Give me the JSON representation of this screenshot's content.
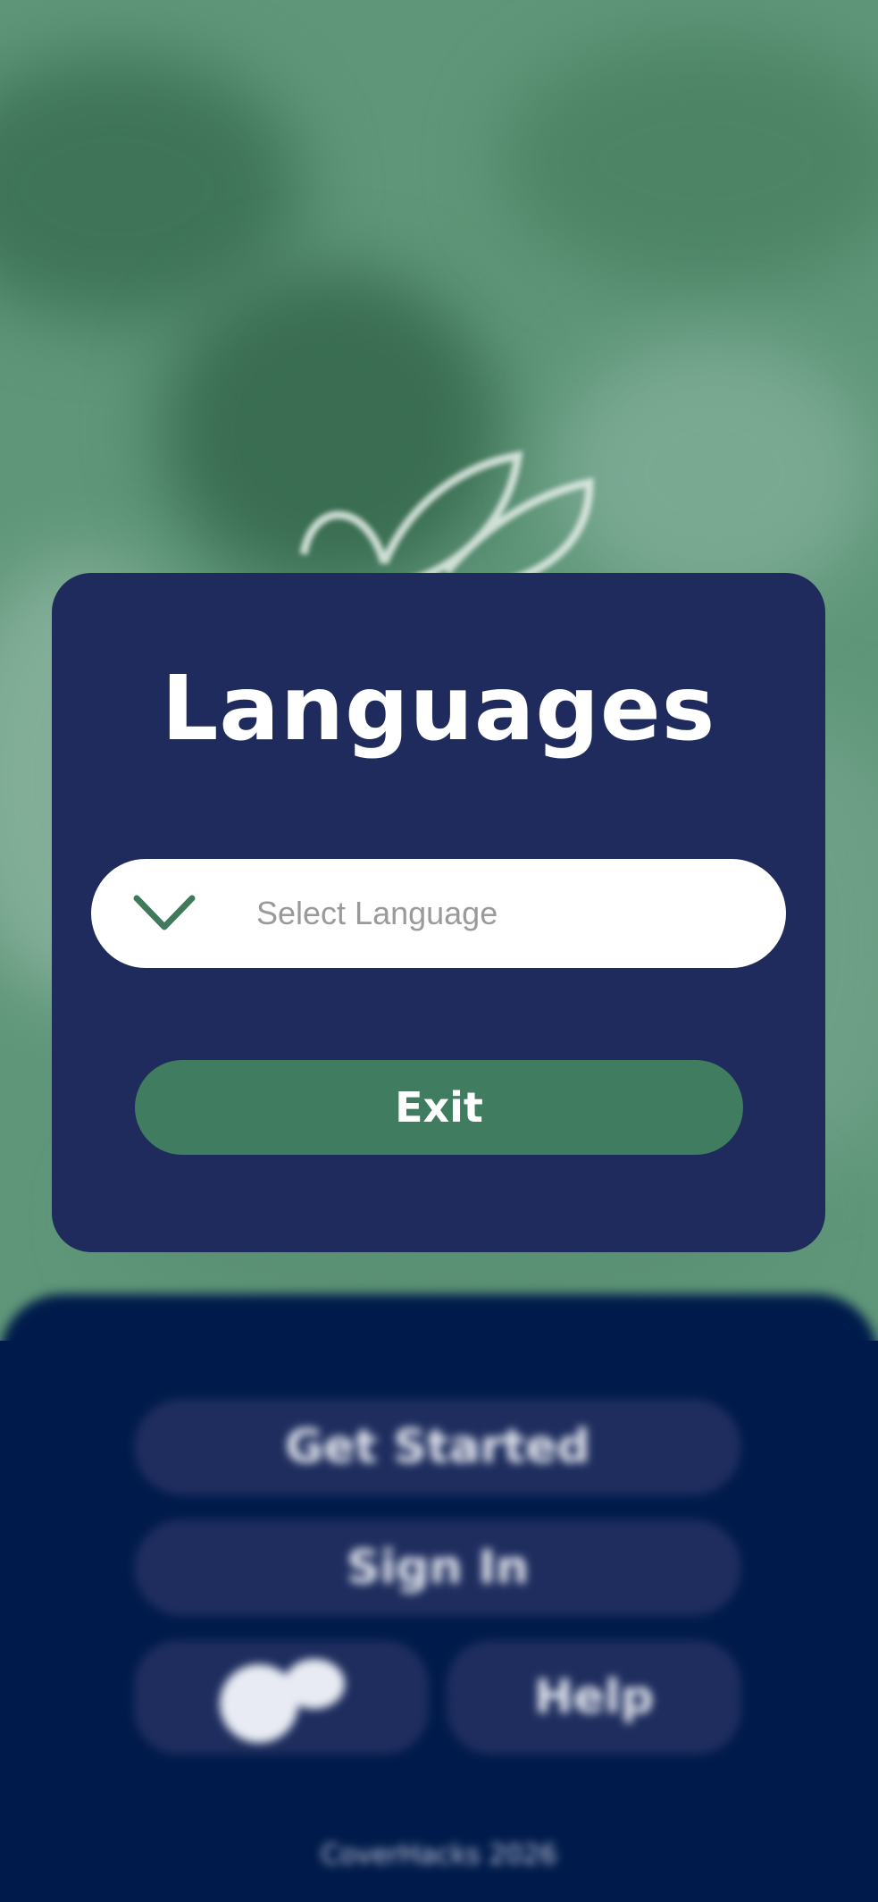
{
  "modal": {
    "title": "Languages",
    "select": {
      "placeholder": "Select Language"
    },
    "exit_label": "Exit"
  },
  "background": {
    "get_started_label": "Get Started",
    "sign_in_label": "Sign In",
    "help_label": "Help",
    "language_icon": "globe-chat-icon",
    "footer_text": "CoverHacks 2026"
  },
  "colors": {
    "photo_tint": "#5f9679",
    "panel": "#001b4b",
    "card": "#1f2b5c",
    "button_dark": "#1e2d5e",
    "accent_green": "#407c5f",
    "chevron": "#3f7a5e"
  },
  "icons": {
    "select_chevron": "chevron-down-icon",
    "logo": "leaf-logo-icon"
  }
}
